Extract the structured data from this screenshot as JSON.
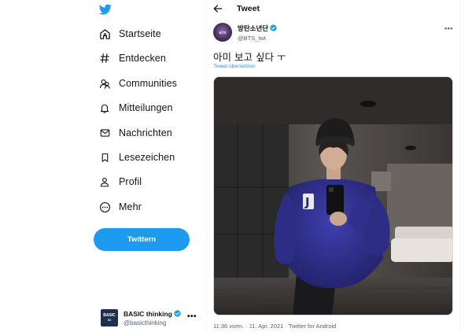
{
  "colors": {
    "accent": "#1d9bf0",
    "text": "#0f1419",
    "secondary": "#536471"
  },
  "nav": {
    "logo_icon": "twitter-bird-icon",
    "items": [
      {
        "label": "Startseite",
        "icon": "home-icon"
      },
      {
        "label": "Entdecken",
        "icon": "hashtag-icon"
      },
      {
        "label": "Communities",
        "icon": "communities-icon"
      },
      {
        "label": "Mitteilungen",
        "icon": "bell-icon"
      },
      {
        "label": "Nachrichten",
        "icon": "envelope-icon"
      },
      {
        "label": "Lesezeichen",
        "icon": "bookmark-icon"
      },
      {
        "label": "Profil",
        "icon": "person-icon"
      },
      {
        "label": "Mehr",
        "icon": "more-circle-icon"
      }
    ],
    "tweet_button": "Twittern",
    "account": {
      "name": "BASIC thinking",
      "handle": "@basicthinking",
      "more": "•••"
    }
  },
  "header": {
    "title": "Tweet",
    "back_icon": "arrow-left-icon"
  },
  "tweet": {
    "author_name": "방탄소년단",
    "author_handle": "@BTS_twt",
    "more": "•••",
    "text": "아미 보고 싶다 ㅜ",
    "translate": "Tweet übersetzen",
    "timestamp": "11:36 vorm. · 11. Apr. 2021 · Twitter for Android"
  }
}
